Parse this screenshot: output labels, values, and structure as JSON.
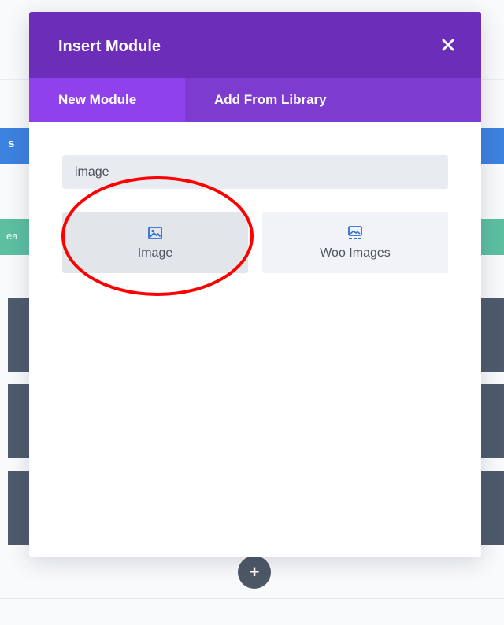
{
  "modal": {
    "title": "Insert Module",
    "close_icon": "close-icon",
    "tabs": [
      {
        "label": "New Module",
        "active": true
      },
      {
        "label": "Add From Library",
        "active": false
      }
    ],
    "search": {
      "value": "image"
    },
    "modules": [
      {
        "label": "Image",
        "icon": "image-icon",
        "selected": true
      },
      {
        "label": "Woo Images",
        "icon": "woo-images-icon",
        "selected": false
      }
    ]
  },
  "background": {
    "left_blue_text": "s",
    "left_green_text": "ea",
    "add_button_icon": "+"
  },
  "colors": {
    "header": "#6c2eb9",
    "tabs": "#7e3bd0",
    "active_tab": "#8f42ec",
    "annotation": "#ff0000"
  }
}
